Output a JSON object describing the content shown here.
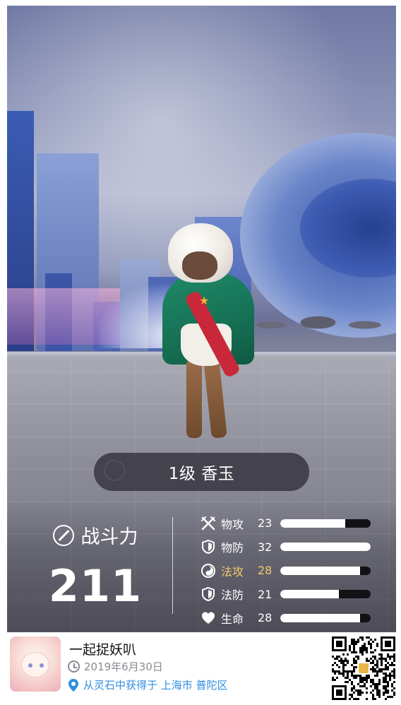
{
  "creature": {
    "name_label": "1级 香玉"
  },
  "power": {
    "label": "战斗力",
    "value": "211"
  },
  "stats": [
    {
      "label": "物攻",
      "value": "23",
      "fraction": 0.72,
      "highlight": false,
      "icon": "crossed-swords-icon"
    },
    {
      "label": "物防",
      "value": "32",
      "fraction": 1.0,
      "highlight": false,
      "icon": "shield-icon"
    },
    {
      "label": "法攻",
      "value": "28",
      "fraction": 0.88,
      "highlight": true,
      "icon": "swirl-icon"
    },
    {
      "label": "法防",
      "value": "21",
      "fraction": 0.65,
      "highlight": false,
      "icon": "shield-icon"
    },
    {
      "label": "生命",
      "value": "28",
      "fraction": 0.88,
      "highlight": false,
      "icon": "heart-icon"
    }
  ],
  "footer": {
    "title": "一起捉妖叭",
    "date": "2019年6月30日",
    "location": "从灵石中获得于 上海市 普陀区"
  },
  "colors": {
    "highlight": "#f0c96a",
    "link": "#2f8fe0",
    "pill_bg": "#3a3842"
  }
}
